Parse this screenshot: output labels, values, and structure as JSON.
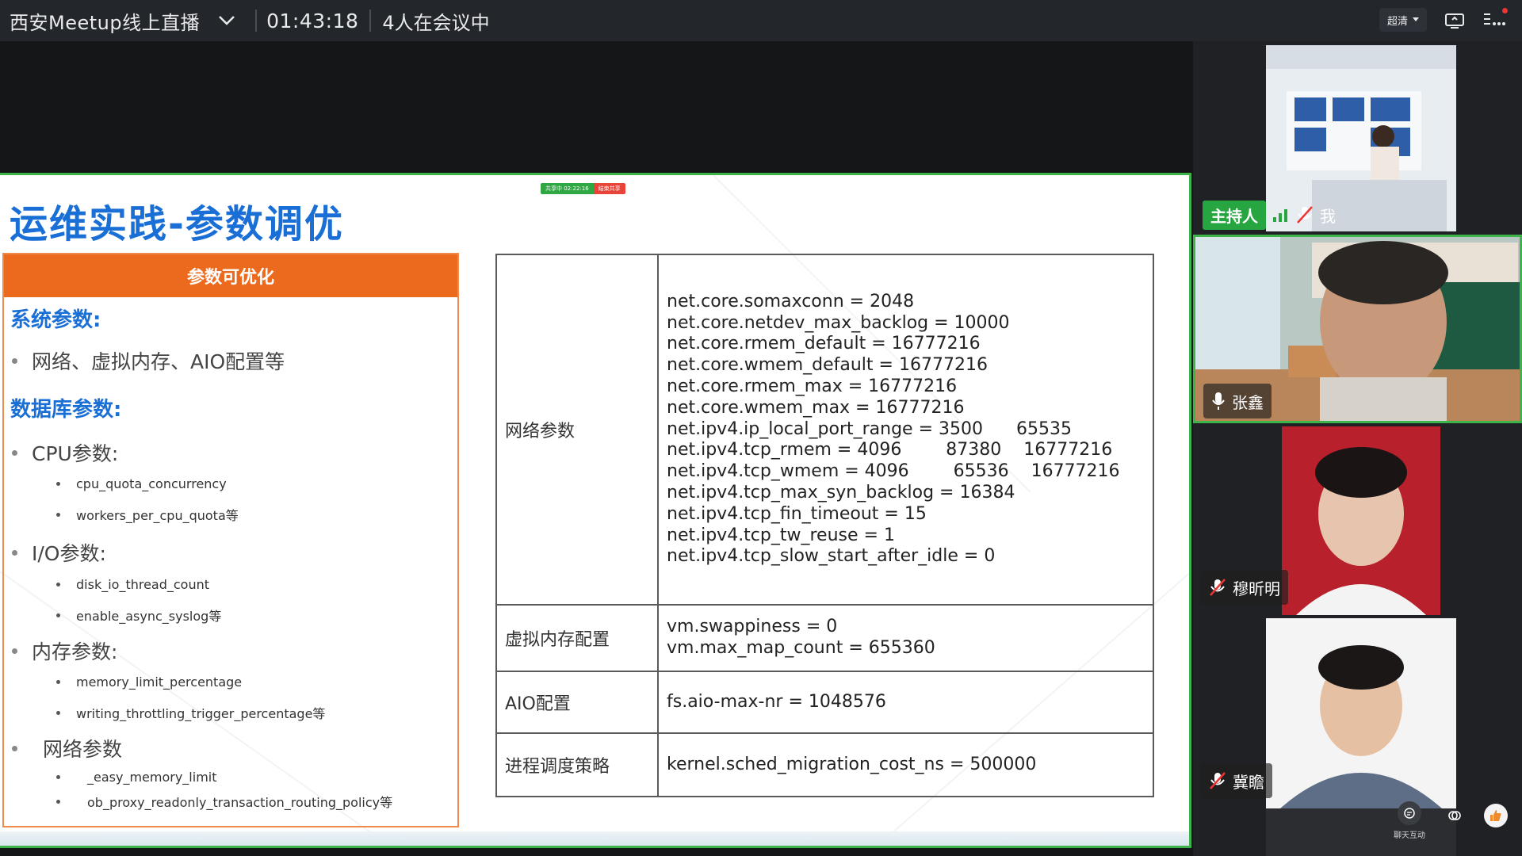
{
  "topbar": {
    "meeting_title": "西安Meetup线上直播",
    "timer": "01:43:18",
    "people_count": "4人在会议中",
    "quality_label": "超清"
  },
  "slide": {
    "share_badge_left": "共享中 02:22:16",
    "share_badge_right": "结束共享",
    "title": "运维实践-参数调优",
    "left_box": {
      "header": "参数可优化",
      "system_params_title": "系统参数:",
      "system_params_item": "网络、虚拟内存、AIO配置等",
      "db_params_title": "数据库参数:",
      "cpu_title": "CPU参数:",
      "cpu_items": [
        "cpu_quota_concurrency",
        "workers_per_cpu_quota等"
      ],
      "io_title": "I/O参数:",
      "io_items": [
        "disk_io_thread_count",
        "enable_async_syslog等"
      ],
      "mem_title": "内存参数:",
      "mem_items": [
        "memory_limit_percentage",
        "writing_throttling_trigger_percentage等"
      ],
      "net_title": "网络参数",
      "net_items": [
        "_easy_memory_limit",
        "ob_proxy_readonly_transaction_routing_policy等"
      ]
    },
    "table": {
      "rows": [
        {
          "key": "网络参数",
          "values": [
            "net.core.somaxconn = 2048",
            "net.core.netdev_max_backlog = 10000",
            "net.core.rmem_default = 16777216",
            "net.core.wmem_default = 16777216",
            "net.core.rmem_max = 16777216",
            "net.core.wmem_max = 16777216",
            "net.ipv4.ip_local_port_range = 3500      65535",
            "net.ipv4.tcp_rmem = 4096        87380    16777216",
            "net.ipv4.tcp_wmem = 4096        65536    16777216",
            "net.ipv4.tcp_max_syn_backlog = 16384",
            "net.ipv4.tcp_fin_timeout = 15",
            "net.ipv4.tcp_tw_reuse = 1",
            "net.ipv4.tcp_slow_start_after_idle = 0"
          ]
        },
        {
          "key": "虚拟内存配置",
          "values": [
            "vm.swappiness = 0",
            "vm.max_map_count = 655360"
          ]
        },
        {
          "key": "AIO配置",
          "values": [
            "fs.aio-max-nr = 1048576"
          ]
        },
        {
          "key": "进程调度策略",
          "values": [
            "kernel.sched_migration_cost_ns = 500000"
          ]
        }
      ]
    }
  },
  "participants": {
    "host_tag": "主持人",
    "p1_name": "我",
    "p2_name": "张鑫",
    "p3_name": "穆昕明",
    "p4_name": "冀瞻"
  },
  "bottom": {
    "chat_label": "聊天互动"
  },
  "colors": {
    "accent_green": "#3cb44a",
    "title_blue": "#1a6fd6",
    "header_orange": "#ec6a1d"
  }
}
